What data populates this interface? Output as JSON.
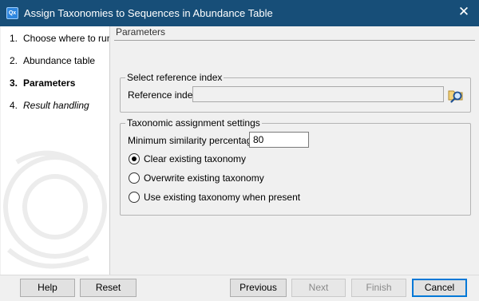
{
  "window": {
    "title": "Assign Taxonomies to Sequences in Abundance Table",
    "app_icon": "Qx"
  },
  "sidebar": {
    "steps": [
      {
        "num": "1.",
        "label": "Choose where to run",
        "state": "normal"
      },
      {
        "num": "2.",
        "label": "Abundance table",
        "state": "normal"
      },
      {
        "num": "3.",
        "label": "Parameters",
        "state": "current"
      },
      {
        "num": "4.",
        "label": "Result handling",
        "state": "upcoming"
      }
    ]
  },
  "main": {
    "header": "Parameters",
    "reference_group": {
      "legend": "Select reference index",
      "label": "Reference index",
      "value": ""
    },
    "taxonomy_group": {
      "legend": "Taxonomic assignment settings",
      "similarity_label": "Minimum similarity percentage",
      "similarity_value": "80",
      "options": [
        {
          "label": "Clear existing taxonomy",
          "checked": true
        },
        {
          "label": "Overwrite existing taxonomy",
          "checked": false
        },
        {
          "label": "Use existing taxonomy when present",
          "checked": false
        }
      ]
    }
  },
  "footer": {
    "help": "Help",
    "reset": "Reset",
    "previous": "Previous",
    "next": "Next",
    "finish": "Finish",
    "cancel": "Cancel"
  },
  "colors": {
    "titlebar": "#174e78",
    "default_button_border": "#0078d7"
  }
}
